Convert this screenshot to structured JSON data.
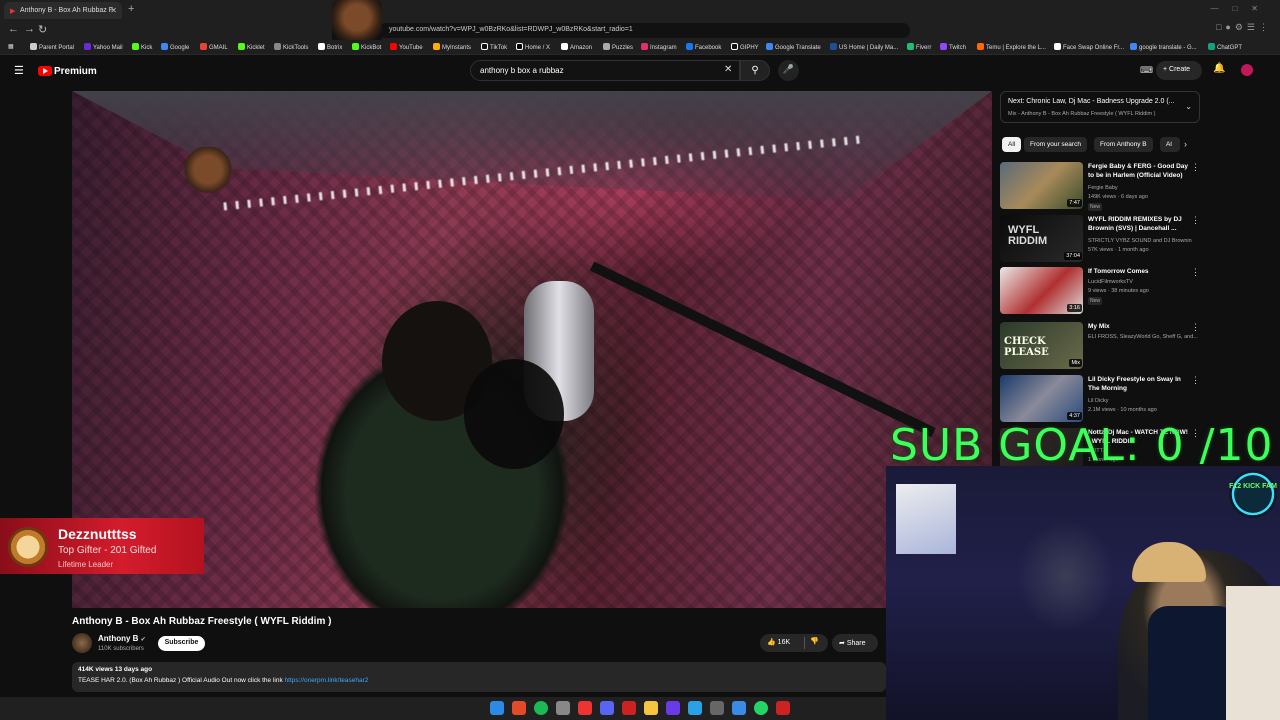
{
  "browser": {
    "tab_title": "Anthony B - Box Ah Rubbaz F",
    "url": "youtube.com/watch?v=WPJ_w0BzRKo&list=RDWPJ_w0BzRKo&start_radio=1",
    "bookmarks": [
      "Parent Portal",
      "Yahoo Mail",
      "Kick",
      "Google",
      "GMAIL",
      "Kicklet",
      "KickTools",
      "Botrix",
      "KickBot",
      "YouTube",
      "MyInstants",
      "TikTok",
      "Home / X",
      "Amazon",
      "Puzzles",
      "Instagram",
      "Facebook",
      "GIPHY",
      "Google Translate",
      "US Home | Daily Ma...",
      "Fiverr",
      "Twitch",
      "Temu | Explore the L...",
      "Face Swap Online Fr...",
      "google translate - G...",
      "ChatGPT"
    ]
  },
  "header": {
    "brand": "Premium",
    "search_query": "anthony b box a rubbaz",
    "create_label": "Create"
  },
  "video": {
    "title": "Anthony B - Box Ah Rubbaz Freestyle ( WYFL Riddim )",
    "channel": "Anthony B",
    "subscribers": "110K subscribers",
    "subscribe_label": "Subscribe",
    "likes": "16K",
    "share_label": "Share",
    "views_date": "414K views  13 days ago",
    "description": "TEASE HAR 2.0. (Box Ah Rubbaz ) Official Audio Out now click the link ",
    "description_link": "https://onerpm.link/teasehar2"
  },
  "overlay": {
    "gifter_name": "Dezznutttss",
    "gifter_sub": "Top Gifter - 201 Gifted",
    "gifter_lead": "Lifetime Leader",
    "sub_goal": "SUB GOAL: 0 /10",
    "kick_logo": "F12 KICK FAM"
  },
  "sidebar": {
    "next_title": "Next: Chronic Law, Dj Mac - Badness Upgrade 2.0 (...",
    "next_sub": "Mix - Anthony B - Box Ah Rubbaz Freestyle ( WYFL Riddim )",
    "chips": [
      "All",
      "From your search",
      "From Anthony B",
      "Al"
    ],
    "recommendations": [
      {
        "title": "Fergie Baby & FERG - Good Day to be in Harlem (Official Video)",
        "channel": "Fergie Baby",
        "meta": "149K views · 6 days ago",
        "badge": "New",
        "duration": "7:47"
      },
      {
        "title": "WYFL RIDDIM REMIXES by DJ Brownin (SVS) | Dancehall ...",
        "channel": "STRICTLY VYBZ SOUND and DJ Brownin",
        "meta": "57K views · 1 month ago",
        "badge": "",
        "duration": "37:04"
      },
      {
        "title": "If Tomorrow Comes",
        "channel": "LucidFilmworksTV",
        "meta": "9 views · 38 minutes ago",
        "badge": "New",
        "duration": "3:16"
      },
      {
        "title": "My Mix",
        "channel": "ELI FROSS, SleazyWorld Go, Sheff G, and...",
        "meta": "",
        "badge": "",
        "duration": "Mix"
      },
      {
        "title": "Lil Dicky Freestyle on Sway In The Morning",
        "channel": "Lil Dicky",
        "meta": "2.1M views · 10 months ago",
        "badge": "",
        "duration": "4:37"
      },
      {
        "title": "Nottz, Dj Mac - WATCH TE NOW! | WYFL RIDDIM",
        "channel": "NOTTZ",
        "meta": "1 month ago",
        "badge": "",
        "duration": ""
      }
    ]
  },
  "colors": {
    "accent": "#ff0000",
    "sub_goal": "#3cff5a",
    "gifter": "#d41c2c",
    "link": "#3ea6ff"
  }
}
